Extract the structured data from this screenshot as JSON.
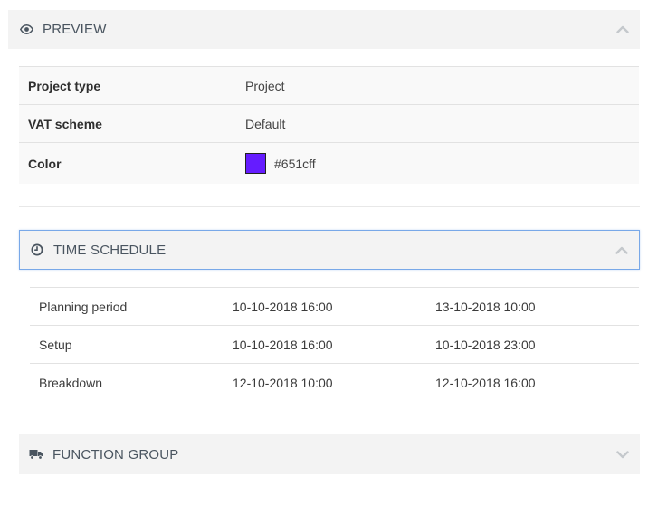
{
  "preview": {
    "title": "PREVIEW",
    "icon": "eye-icon",
    "chevron": "chevron-up-icon",
    "rows": [
      {
        "label": "Project type",
        "value": "Project"
      },
      {
        "label": "VAT scheme",
        "value": "Default"
      },
      {
        "label": "Color",
        "value": "#651cff",
        "swatch_color": "#651cff"
      }
    ]
  },
  "time_schedule": {
    "title": "TIME SCHEDULE",
    "icon": "clock-icon",
    "chevron": "chevron-up-icon",
    "rows": [
      {
        "name": "Planning period",
        "start": "10-10-2018 16:00",
        "end": "13-10-2018 10:00"
      },
      {
        "name": "Setup",
        "start": "10-10-2018 16:00",
        "end": "10-10-2018 23:00"
      },
      {
        "name": "Breakdown",
        "start": "12-10-2018 10:00",
        "end": "12-10-2018 16:00"
      }
    ]
  },
  "function_group": {
    "title": "FUNCTION GROUP",
    "icon": "truck-icon",
    "chevron": "chevron-down-icon"
  },
  "colors": {
    "header_bg": "#f3f3f3",
    "active_border": "#78a8e8"
  }
}
